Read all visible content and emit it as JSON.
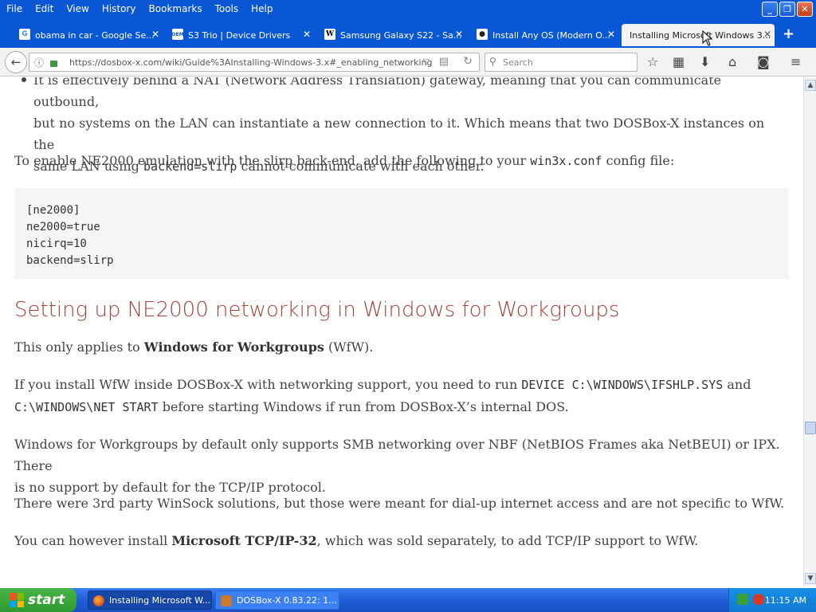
{
  "menus": [
    "File",
    "Edit",
    "View",
    "History",
    "Bookmarks",
    "Tools",
    "Help"
  ],
  "tabs": [
    {
      "title": "obama in car - Google Se...",
      "icon": "google-icon",
      "icon_glyph": "G",
      "active": false
    },
    {
      "title": "S3 Trio | Device Drivers",
      "icon": "oem-icon",
      "icon_glyph": "OEM",
      "active": false
    },
    {
      "title": "Samsung Galaxy S22 - Sa...",
      "icon": "wikipedia-icon",
      "icon_glyph": "W",
      "active": false
    },
    {
      "title": "Install Any OS (Modern O...",
      "icon": "github-icon",
      "icon_glyph": "●",
      "active": false
    },
    {
      "title": "Installing Microsoft Windows 3...",
      "icon": "",
      "icon_glyph": "",
      "active": true
    }
  ],
  "nav": {
    "url": "https://dosbox-x.com/wiki/Guide%3AInstalling-Windows-3.x#_enabling_networking",
    "search_placeholder": "Search"
  },
  "content": {
    "bullet_line1": "It is effectively behind a NAT (Network Address Translation) gateway, meaning that you can communicate outbound,",
    "bullet_line2": "but no systems on the LAN can instantiate a new connection to it. Which means that two DOSBox-X instances on the",
    "bullet_line3_pre": "same LAN using",
    "bullet_line3_code": "backend=slirp",
    "bullet_line3_post": "cannot communicate with each other.",
    "enable_pre": "To enable NE2000 emulation with the slirp back-end, add the following to your",
    "enable_code": "win3x.conf",
    "enable_post": "config file:",
    "code_lines": [
      "[ne2000]",
      "ne2000=true",
      "nicirq=10",
      "backend=slirp"
    ],
    "heading": "Setting up NE2000 networking in Windows for Workgroups",
    "applies_pre": "This only applies to",
    "applies_bold": "Windows for Workgroups",
    "applies_post": "(WfW).",
    "install_pre": "If you install WfW inside DOSBox-X with networking support, you need to run",
    "install_code1": "DEVICE C:\\WINDOWS\\IFSHLP.SYS",
    "install_and": "and",
    "install_code2": "C:\\WINDOWS\\NET START",
    "install_post": "before starting Windows if run from DOSBox-X’s internal DOS.",
    "smb_line1": "Windows for Workgroups by default only supports SMB networking over NBF (NetBIOS Frames aka NetBEUI) or IPX. There",
    "smb_line2": "is no support by default for the TCP/IP protocol.",
    "winsock": "There were 3rd party WinSock solutions, but those were meant for dial-up internet access and are not specific to WfW.",
    "tcp_pre": "You can however install",
    "tcp_bold": "Microsoft TCP/IP-32",
    "tcp_post": ", which was sold separately, to add TCP/IP support to WfW."
  },
  "taskbar": {
    "start_label": "start",
    "tasks": [
      {
        "label": "Installing Microsoft W...",
        "icon": "firefox-icon"
      },
      {
        "label": "DOSBox-X 0.83.22: 1...",
        "icon": "dosbox-icon"
      }
    ],
    "clock": "11:15 AM"
  },
  "colors": {
    "heading": "#a4433a",
    "titlebar": "#0a57d6",
    "taskbar": "#1f5ed8",
    "start": "#2f9a2f"
  }
}
